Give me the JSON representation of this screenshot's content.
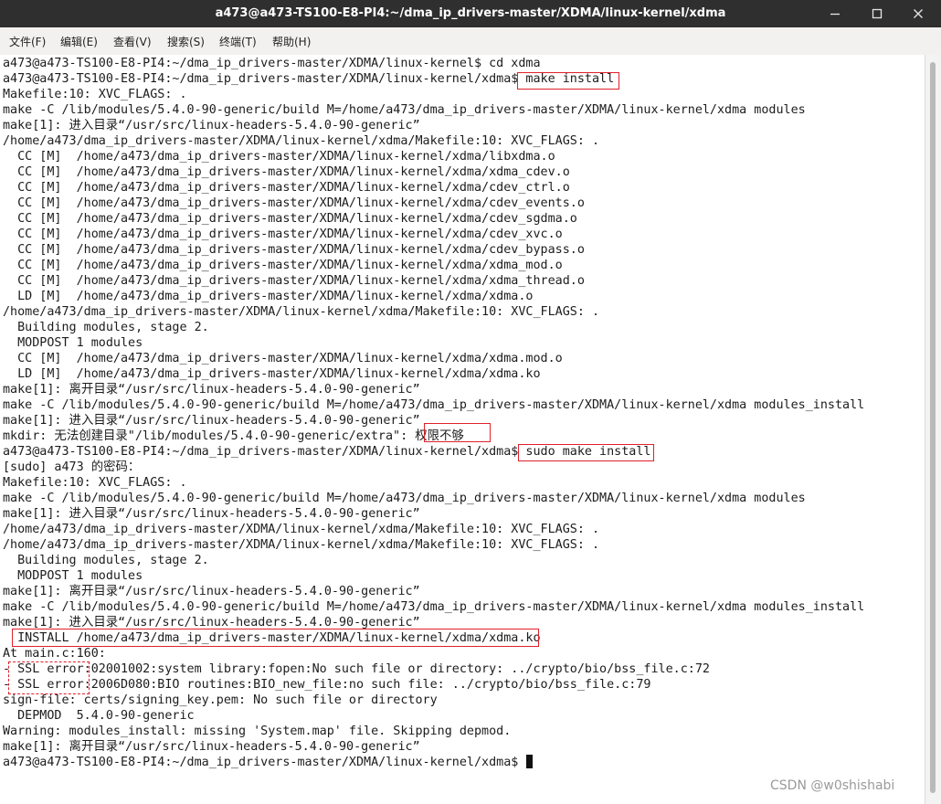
{
  "window": {
    "title": "a473@a473-TS100-E8-PI4:~/dma_ip_drivers-master/XDMA/linux-kernel/xdma",
    "minimize_label": "Minimize",
    "maximize_label": "Maximize",
    "close_label": "Close"
  },
  "menu": {
    "items": [
      {
        "label": "文件(F)"
      },
      {
        "label": "编辑(E)"
      },
      {
        "label": "查看(V)"
      },
      {
        "label": "搜索(S)"
      },
      {
        "label": "终端(T)"
      },
      {
        "label": "帮助(H)"
      }
    ]
  },
  "terminal": {
    "lines": [
      "a473@a473-TS100-E8-PI4:~/dma_ip_drivers-master/XDMA/linux-kernel$ cd xdma",
      "a473@a473-TS100-E8-PI4:~/dma_ip_drivers-master/XDMA/linux-kernel/xdma$ make install",
      "Makefile:10: XVC_FLAGS: .",
      "make -C /lib/modules/5.4.0-90-generic/build M=/home/a473/dma_ip_drivers-master/XDMA/linux-kernel/xdma modules",
      "make[1]: 进入目录“/usr/src/linux-headers-5.4.0-90-generic”",
      "/home/a473/dma_ip_drivers-master/XDMA/linux-kernel/xdma/Makefile:10: XVC_FLAGS: .",
      "  CC [M]  /home/a473/dma_ip_drivers-master/XDMA/linux-kernel/xdma/libxdma.o",
      "  CC [M]  /home/a473/dma_ip_drivers-master/XDMA/linux-kernel/xdma/xdma_cdev.o",
      "  CC [M]  /home/a473/dma_ip_drivers-master/XDMA/linux-kernel/xdma/cdev_ctrl.o",
      "  CC [M]  /home/a473/dma_ip_drivers-master/XDMA/linux-kernel/xdma/cdev_events.o",
      "  CC [M]  /home/a473/dma_ip_drivers-master/XDMA/linux-kernel/xdma/cdev_sgdma.o",
      "  CC [M]  /home/a473/dma_ip_drivers-master/XDMA/linux-kernel/xdma/cdev_xvc.o",
      "  CC [M]  /home/a473/dma_ip_drivers-master/XDMA/linux-kernel/xdma/cdev_bypass.o",
      "  CC [M]  /home/a473/dma_ip_drivers-master/XDMA/linux-kernel/xdma/xdma_mod.o",
      "  CC [M]  /home/a473/dma_ip_drivers-master/XDMA/linux-kernel/xdma/xdma_thread.o",
      "  LD [M]  /home/a473/dma_ip_drivers-master/XDMA/linux-kernel/xdma/xdma.o",
      "/home/a473/dma_ip_drivers-master/XDMA/linux-kernel/xdma/Makefile:10: XVC_FLAGS: .",
      "  Building modules, stage 2.",
      "  MODPOST 1 modules",
      "  CC [M]  /home/a473/dma_ip_drivers-master/XDMA/linux-kernel/xdma/xdma.mod.o",
      "  LD [M]  /home/a473/dma_ip_drivers-master/XDMA/linux-kernel/xdma/xdma.ko",
      "make[1]: 离开目录“/usr/src/linux-headers-5.4.0-90-generic”",
      "make -C /lib/modules/5.4.0-90-generic/build M=/home/a473/dma_ip_drivers-master/XDMA/linux-kernel/xdma modules_install",
      "make[1]: 进入目录“/usr/src/linux-headers-5.4.0-90-generic”",
      "mkdir: 无法创建目录\"/lib/modules/5.4.0-90-generic/extra\": 权限不够",
      "a473@a473-TS100-E8-PI4:~/dma_ip_drivers-master/XDMA/linux-kernel/xdma$ sudo make install",
      "[sudo] a473 的密码：",
      "Makefile:10: XVC_FLAGS: .",
      "make -C /lib/modules/5.4.0-90-generic/build M=/home/a473/dma_ip_drivers-master/XDMA/linux-kernel/xdma modules",
      "make[1]: 进入目录“/usr/src/linux-headers-5.4.0-90-generic”",
      "/home/a473/dma_ip_drivers-master/XDMA/linux-kernel/xdma/Makefile:10: XVC_FLAGS: .",
      "/home/a473/dma_ip_drivers-master/XDMA/linux-kernel/xdma/Makefile:10: XVC_FLAGS: .",
      "  Building modules, stage 2.",
      "  MODPOST 1 modules",
      "make[1]: 离开目录“/usr/src/linux-headers-5.4.0-90-generic”",
      "make -C /lib/modules/5.4.0-90-generic/build M=/home/a473/dma_ip_drivers-master/XDMA/linux-kernel/xdma modules_install",
      "make[1]: 进入目录“/usr/src/linux-headers-5.4.0-90-generic”",
      "  INSTALL /home/a473/dma_ip_drivers-master/XDMA/linux-kernel/xdma/xdma.ko",
      "At main.c:160:",
      "- SSL error:02001002:system library:fopen:No such file or directory: ../crypto/bio/bss_file.c:72",
      "- SSL error:2006D080:BIO routines:BIO_new_file:no such file: ../crypto/bio/bss_file.c:79",
      "sign-file: certs/signing_key.pem: No such file or directory",
      "  DEPMOD  5.4.0-90-generic",
      "Warning: modules_install: missing 'System.map' file. Skipping depmod.",
      "make[1]: 离开目录“/usr/src/linux-headers-5.4.0-90-generic”",
      "a473@a473-TS100-E8-PI4:~/dma_ip_drivers-master/XDMA/linux-kernel/xdma$ "
    ]
  },
  "colors": {
    "titlebar": "#2f2f2f",
    "menubar": "#f2f1f0",
    "terminal_bg": "#ffffff",
    "terminal_fg": "#1c1c1c",
    "annotation": "#e0202a"
  },
  "icons": {
    "minimize": "minimize-icon",
    "maximize": "maximize-icon",
    "close": "close-icon"
  },
  "watermark": "CSDN @w0shishabi"
}
